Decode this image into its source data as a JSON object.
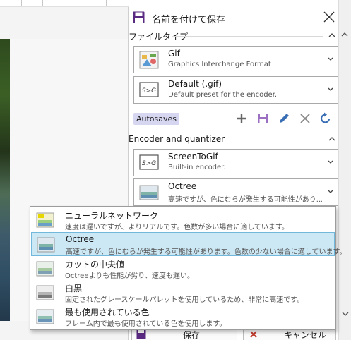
{
  "dialog": {
    "title": "名前を付けて保存",
    "close_icon": "close-icon"
  },
  "file_type_section": {
    "label": "ファイルタイプ",
    "format": {
      "title": "Gif",
      "subtitle": "Graphics Interchange Format"
    },
    "preset": {
      "title": "Default (.gif)",
      "subtitle": "Default preset for the encoder."
    },
    "autosaves_label": "Autosaves",
    "toolbar_icons": [
      "add-icon",
      "save-icon",
      "edit-icon",
      "delete-icon",
      "reset-icon"
    ]
  },
  "encoder_section": {
    "label": "Encoder and quantizer",
    "encoder": {
      "title": "ScreenToGif",
      "subtitle": "Built-in encoder."
    },
    "quantizer": {
      "title": "Octree",
      "subtitle": "高速ですが、色にむらが発生する可能性があり..."
    }
  },
  "quantizer_options": [
    {
      "title": "ニューラルネットワーク",
      "subtitle": "速度は遅いですが、よりリアルです。色数が多い場合に適しています。",
      "selected": false
    },
    {
      "title": "Octree",
      "subtitle": "高速ですが、色にむらが発生する可能性があります。色数の少ない場合に適しています。",
      "selected": true
    },
    {
      "title": "カットの中央値",
      "subtitle": "Octreeよりも性能が劣り、速度も遅い。",
      "selected": false
    },
    {
      "title": "白黒",
      "subtitle": "固定されたグレースケールパレットを使用しているため、非常に高速です。",
      "selected": false
    },
    {
      "title": "最も使用されている色",
      "subtitle": "フレーム内で最も使用されている色を使用します。",
      "selected": false
    }
  ],
  "buttons": {
    "save": "保存",
    "cancel": "キャンセル"
  },
  "colors": {
    "accent": "#3b6fb5",
    "autosaves_bg": "#d6d6f0",
    "save_purple": "#5a2a82",
    "selected_bg": "#cce8f5",
    "cancel_red": "#c0392b"
  }
}
